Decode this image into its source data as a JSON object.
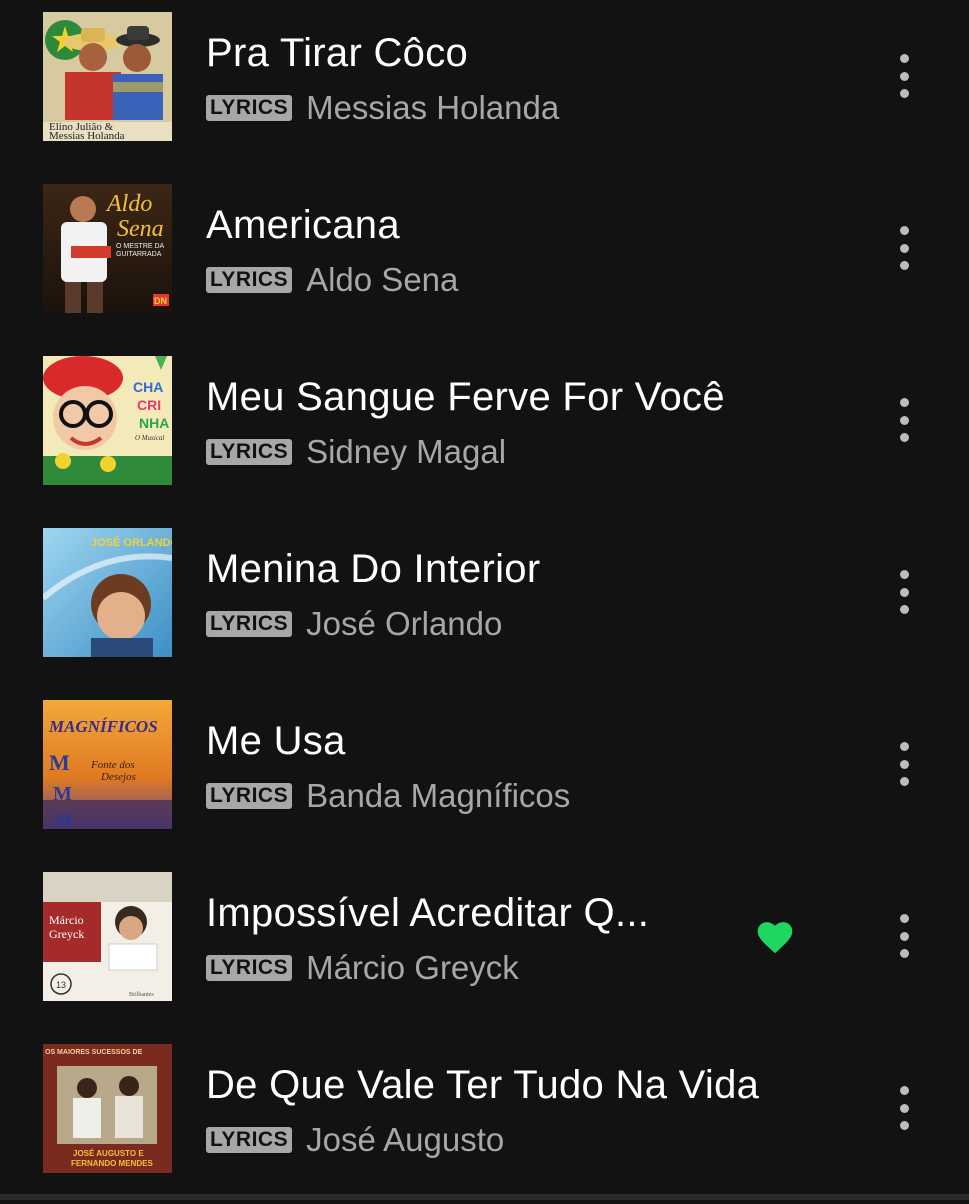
{
  "tracks": [
    {
      "title": "Pra Tirar Côco",
      "badge": "LYRICS",
      "artist": "Messias Holanda",
      "liked": false,
      "cover_text": [
        "Elino Julião &",
        "Messias Holanda"
      ]
    },
    {
      "title": "Americana",
      "badge": "LYRICS",
      "artist": "Aldo Sena",
      "liked": false,
      "cover_text": [
        "Aldo",
        "Sena",
        "O MESTRE DA",
        "GUITARRADA",
        "DN"
      ]
    },
    {
      "title": "Meu Sangue Ferve For Você",
      "badge": "LYRICS",
      "artist": "Sidney Magal",
      "liked": false,
      "cover_text": [
        "CHA",
        "CRI",
        "NHA",
        "O Musical"
      ]
    },
    {
      "title": "Menina Do Interior",
      "badge": "LYRICS",
      "artist": "José Orlando",
      "liked": false,
      "cover_text": [
        "JOSÉ ORLANDO"
      ]
    },
    {
      "title": "Me Usa",
      "badge": "LYRICS",
      "artist": "Banda Magníficos",
      "liked": false,
      "cover_text": [
        "MAGNÍFICOS",
        "Fonte dos",
        "Desejos",
        "M",
        "M",
        "M"
      ]
    },
    {
      "title": "Impossível Acreditar Q...",
      "badge": "LYRICS",
      "artist": "Márcio Greyck",
      "liked": true,
      "cover_text": [
        "Márcio",
        "Greyck",
        "13",
        "Brilhantes"
      ]
    },
    {
      "title": "De Que Vale Ter Tudo Na Vida",
      "badge": "LYRICS",
      "artist": "José Augusto",
      "liked": false,
      "cover_text": [
        "OS MAIORES SUCESSOS DE",
        "JOSÉ AUGUSTO E",
        "FERNANDO MENDES"
      ]
    }
  ],
  "colors": {
    "background": "#121212",
    "title": "#ffffff",
    "secondary": "#a7a7a7",
    "liked": "#1ed760"
  },
  "icons": {
    "liked": "heart-filled-icon",
    "more": "more-vertical-icon"
  }
}
